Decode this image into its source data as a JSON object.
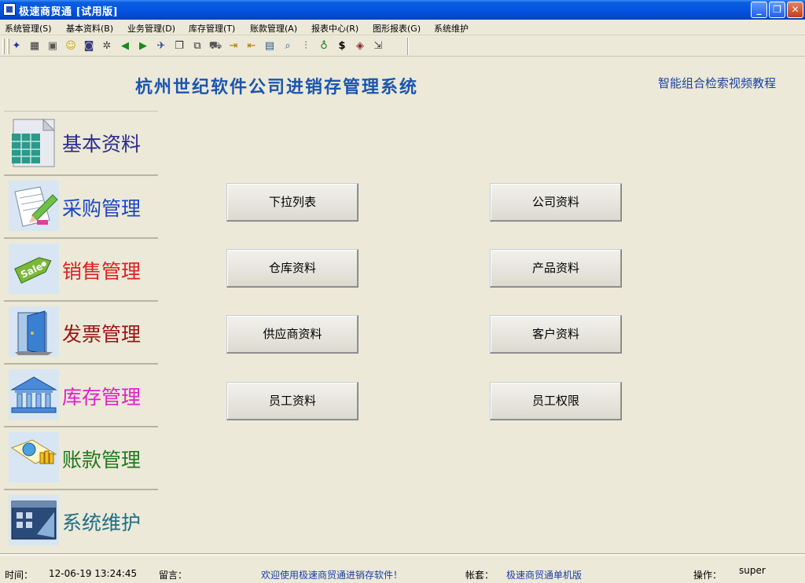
{
  "window": {
    "title": "极速商贸通 [试用版]",
    "buttons": {
      "minimize": "_",
      "restore": "❐",
      "close": "✕"
    }
  },
  "menubar": {
    "items": [
      "系统管理(S)",
      "基本资料(B)",
      "业务管理(D)",
      "库存管理(T)",
      "账款管理(A)",
      "报表中心(R)",
      "图形报表(G)",
      "系统维护"
    ]
  },
  "toolbar": {
    "icons": [
      "butterfly-icon",
      "calculator-icon",
      "chat-icon",
      "smile-icon",
      "disk-icon",
      "gear-icon",
      "arrow-left-icon",
      "arrow-right-icon",
      "plane-icon",
      "window-icon",
      "copy-icon",
      "truck-icon",
      "import-icon",
      "export-icon",
      "computer-icon",
      "search-icon",
      "chart-icon",
      "money-bag-icon",
      "dollar-icon",
      "book-icon",
      "exit-icon"
    ]
  },
  "header": {
    "system_title": "杭州世纪软件公司进销存管理系统",
    "video_link": "智能组合检索视频教程"
  },
  "sidebar": {
    "items": [
      {
        "label": "基本资料",
        "color": "#2a2a8c"
      },
      {
        "label": "采购管理",
        "color": "#1b46c6"
      },
      {
        "label": "销售管理",
        "color": "#e01e1e"
      },
      {
        "label": "发票管理",
        "color": "#9a1414"
      },
      {
        "label": "库存管理",
        "color": "#e020c8"
      },
      {
        "label": "账款管理",
        "color": "#1e7a1e"
      },
      {
        "label": "系统维护",
        "color": "#1f6f84"
      }
    ]
  },
  "main": {
    "buttons": [
      "下拉列表",
      "公司资料",
      "仓库资料",
      "产品资料",
      "供应商资料",
      "客户资料",
      "员工资料",
      "员工权限"
    ]
  },
  "status": {
    "time_label": "时间：",
    "time_value": "12-06-19 13:24:45",
    "message_label": "留言：",
    "welcome": "欢迎使用极速商贸通进销存软件！",
    "account_label": "帐套：",
    "account_value": "极速商贸通单机版",
    "operator_label": "操作：",
    "operator_value": "super"
  }
}
